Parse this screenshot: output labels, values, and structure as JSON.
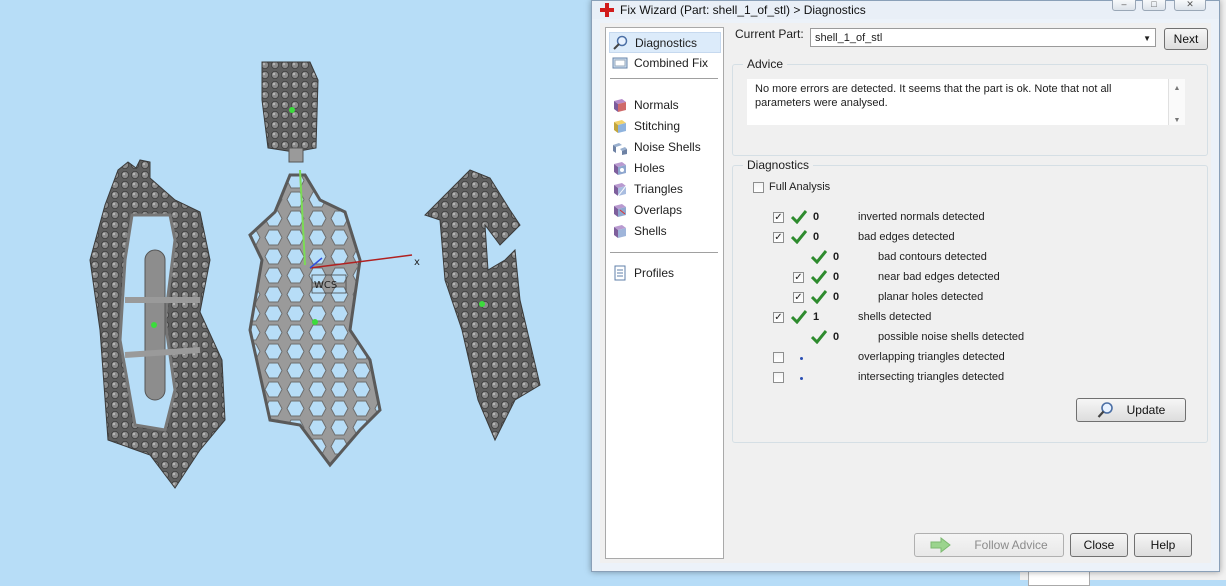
{
  "dialog": {
    "title": "Fix Wizard (Part: shell_1_of_stl) > Diagnostics"
  },
  "nav": {
    "items": [
      {
        "label": "Diagnostics"
      },
      {
        "label": "Combined Fix"
      },
      {
        "label": "Normals"
      },
      {
        "label": "Stitching"
      },
      {
        "label": "Noise Shells"
      },
      {
        "label": "Holes"
      },
      {
        "label": "Triangles"
      },
      {
        "label": "Overlaps"
      },
      {
        "label": "Shells"
      },
      {
        "label": "Profiles"
      }
    ]
  },
  "current_part": {
    "label": "Current Part:",
    "value": "shell_1_of_stl",
    "next_label": "Next"
  },
  "advice": {
    "title": "Advice",
    "text": "No more errors are detected. It seems that the part is ok. Note that not all parameters were analysed."
  },
  "diagnostics": {
    "title": "Diagnostics",
    "full_analysis_label": "Full Analysis",
    "rows": [
      {
        "count": "0",
        "label": "inverted normals detected"
      },
      {
        "count": "0",
        "label": "bad edges detected"
      },
      {
        "count": "0",
        "label": "bad contours detected"
      },
      {
        "count": "0",
        "label": "near bad edges detected"
      },
      {
        "count": "0",
        "label": "planar holes detected"
      },
      {
        "count": "1",
        "label": "shells detected"
      },
      {
        "count": "0",
        "label": "possible noise shells detected"
      },
      {
        "count": "",
        "label": "overlapping triangles detected"
      },
      {
        "count": "",
        "label": "intersecting triangles detected"
      }
    ],
    "update_label": "Update"
  },
  "footer": {
    "follow_advice_label": "Follow Advice",
    "close_label": "Close",
    "help_label": "Help"
  },
  "viewport": {
    "axis_x_label": "x",
    "wcs_label": "WCS"
  },
  "colors": {
    "viewport_bg": "#b7ddf7",
    "check_green": "#2e8b2e",
    "selected_nav": "#dcebfa"
  }
}
